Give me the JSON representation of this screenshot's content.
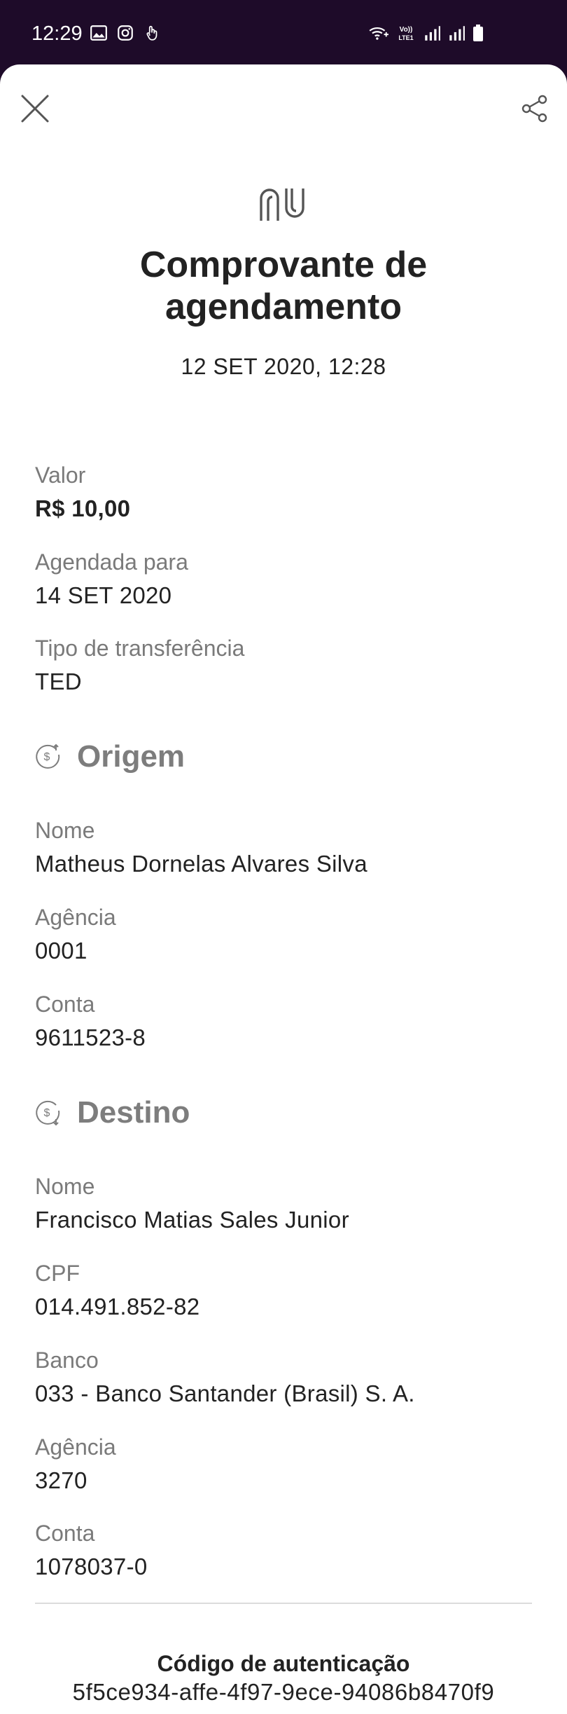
{
  "status_bar": {
    "time": "12:29",
    "left_icons": [
      "gallery-icon",
      "instagram-icon",
      "touch-icon"
    ],
    "right_icons": [
      "wifi-calling-icon",
      "volte-icon",
      "signal-icon",
      "signal-icon-2",
      "battery-icon"
    ],
    "volte_text": "Vo)) LTE1"
  },
  "header": {
    "close_icon": "close-icon",
    "share_icon": "share-icon",
    "logo": "nu"
  },
  "receipt": {
    "title_line1": "Comprovante de",
    "title_line2": "agendamento",
    "datetime": "12 SET 2020, 12:28"
  },
  "summary": {
    "valor_label": "Valor",
    "valor_value": "R$ 10,00",
    "agendada_label": "Agendada para",
    "agendada_value": "14 SET 2020",
    "tipo_label": "Tipo de transferência",
    "tipo_value": "TED"
  },
  "origem": {
    "title": "Origem",
    "nome_label": "Nome",
    "nome_value": "Matheus Dornelas Alvares Silva",
    "agencia_label": "Agência",
    "agencia_value": "0001",
    "conta_label": "Conta",
    "conta_value": "9611523-8"
  },
  "destino": {
    "title": "Destino",
    "nome_label": "Nome",
    "nome_value": "Francisco Matias Sales Junior",
    "cpf_label": "CPF",
    "cpf_value": "014.491.852-82",
    "banco_label": "Banco",
    "banco_value": "033 - Banco Santander (Brasil) S. A.",
    "agencia_label": "Agência",
    "agencia_value": "3270",
    "conta_label": "Conta",
    "conta_value": "1078037-0"
  },
  "auth": {
    "label": "Código de autenticação",
    "code": "5f5ce934-affe-4f97-9ece-94086b8470f9"
  },
  "colors": {
    "status_bar_bg": "#1e0b29",
    "card_bg": "#ffffff",
    "label_gray": "#7a7a7a",
    "text_dark": "#222222"
  }
}
